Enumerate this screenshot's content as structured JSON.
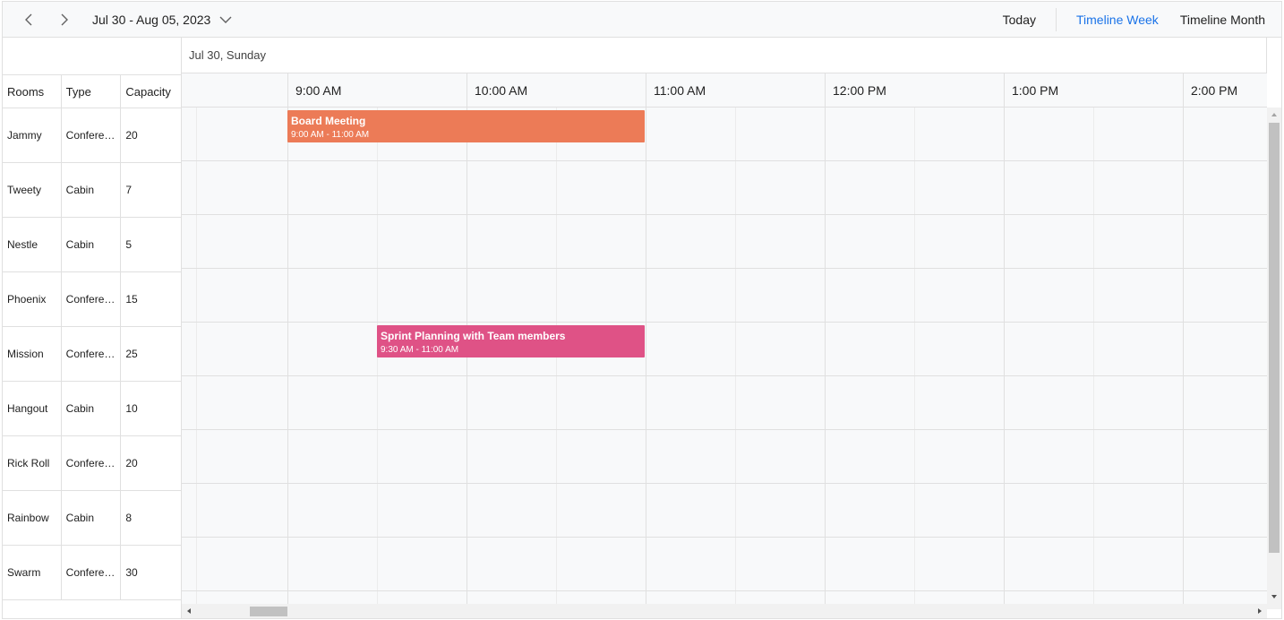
{
  "toolbar": {
    "date_range": "Jul 30 - Aug 05, 2023",
    "today": "Today",
    "views": [
      "Timeline Week",
      "Timeline Month"
    ],
    "active_view": "Timeline Week",
    "prev_icon": "chevron-left-icon",
    "next_icon": "chevron-right-icon",
    "dropdown_icon": "chevron-down-icon"
  },
  "resource_headers": [
    "Rooms",
    "Type",
    "Capacity"
  ],
  "rooms": [
    {
      "name": "Jammy",
      "type": "Conference",
      "capacity": "20"
    },
    {
      "name": "Tweety",
      "type": "Cabin",
      "capacity": "7"
    },
    {
      "name": "Nestle",
      "type": "Cabin",
      "capacity": "5"
    },
    {
      "name": "Phoenix",
      "type": "Conference",
      "capacity": "15"
    },
    {
      "name": "Mission",
      "type": "Conference",
      "capacity": "25"
    },
    {
      "name": "Hangout",
      "type": "Cabin",
      "capacity": "10"
    },
    {
      "name": "Rick Roll",
      "type": "Conference",
      "capacity": "20"
    },
    {
      "name": "Rainbow",
      "type": "Cabin",
      "capacity": "8"
    },
    {
      "name": "Swarm",
      "type": "Conference",
      "capacity": "30"
    }
  ],
  "date_header": "Jul 30, Sunday",
  "time_slots": [
    "9:00 AM",
    "10:00 AM",
    "11:00 AM",
    "12:00 PM",
    "1:00 PM",
    "2:00 PM"
  ],
  "appointments": [
    {
      "subject": "Board Meeting",
      "time": "9:00 AM - 11:00 AM",
      "room_index": 0,
      "start_hour": 9.0,
      "end_hour": 11.0,
      "color": "#ec7b57"
    },
    {
      "subject": "Sprint Planning with Team members",
      "time": "9:30 AM - 11:00 AM",
      "room_index": 4,
      "start_hour": 9.5,
      "end_hour": 11.0,
      "color": "#df5286"
    }
  ],
  "colors": {
    "accent": "#1a73e8",
    "board_meeting": "#ec7b57",
    "sprint_planning": "#df5286"
  }
}
